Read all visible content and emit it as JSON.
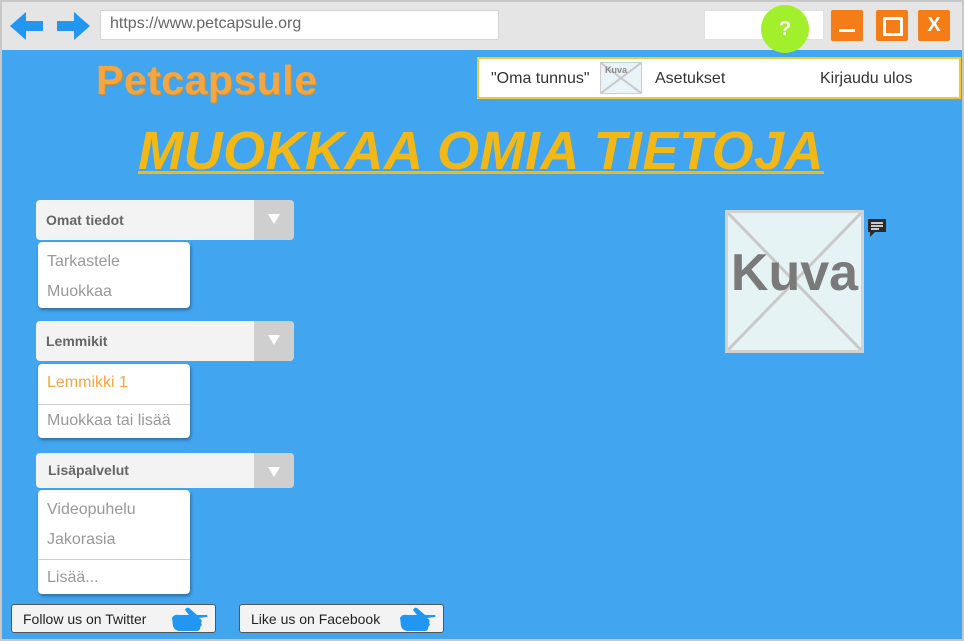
{
  "browser": {
    "url": "https://www.petcapsule.org",
    "help_label": "?",
    "close_label": "X",
    "back_icon": "arrow-left-icon",
    "forward_icon": "arrow-right-icon"
  },
  "colors": {
    "page_background": "#42a5f0",
    "logo": "#f4a640",
    "title": "#f2b816",
    "help_button": "#a2f02b",
    "window_buttons": "#f47d17",
    "userbar_border": "#f0c934"
  },
  "header": {
    "logo": "Petcapsule",
    "username": "\"Oma tunnus\"",
    "avatar_label": "Kuva",
    "settings": "Asetukset",
    "logout": "Kirjaudu ulos"
  },
  "page_title": "MUOKKAA OMIA TIETOJA",
  "sidebar": {
    "groups": [
      {
        "title": "Omat tiedot",
        "items": [
          "Tarkastele",
          "Muokkaa"
        ]
      },
      {
        "title": "Lemmikit",
        "items": [
          "Lemmikki 1",
          "Muokkaa tai lisää"
        ]
      },
      {
        "title": "Lisäpalvelut",
        "items": [
          "Videopuhelu",
          "Jakorasia",
          "Lisää..."
        ]
      }
    ]
  },
  "profile": {
    "photo_label": "Kuva",
    "comment_icon": "comment-icon"
  },
  "social": {
    "twitter": "Follow us on Twitter",
    "facebook": "Like us on Facebook",
    "icon": "thumbs-up-icon"
  }
}
